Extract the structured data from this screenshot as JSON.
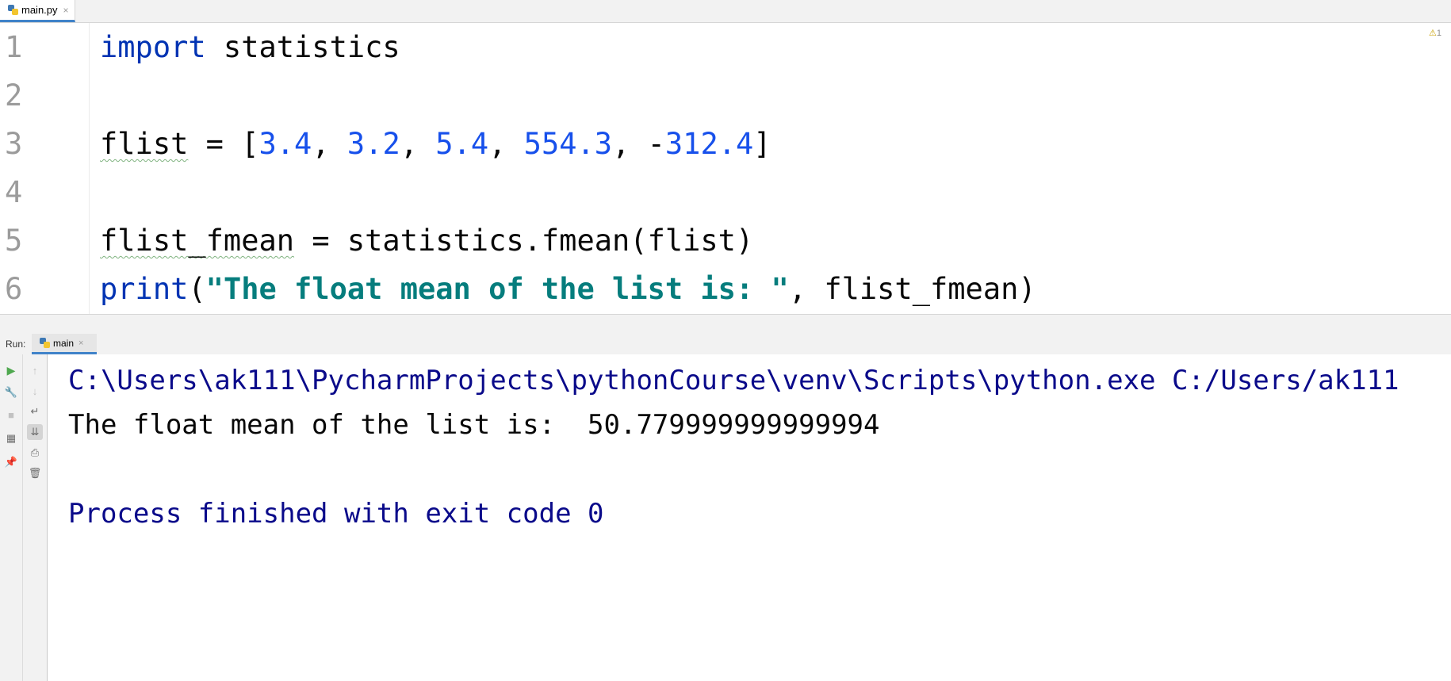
{
  "editor_tab": {
    "filename": "main.py",
    "close": "×"
  },
  "inspection": {
    "warning_count": "1"
  },
  "code": {
    "lines": [
      {
        "n": "1"
      },
      {
        "n": "2"
      },
      {
        "n": "3"
      },
      {
        "n": "4"
      },
      {
        "n": "5"
      },
      {
        "n": "6"
      }
    ],
    "l1": {
      "kw": "import",
      "rest": " statistics"
    },
    "l3": {
      "var": "flist",
      "eq": " = [",
      "n1": "3.4",
      "c1": ", ",
      "n2": "3.2",
      "c2": ", ",
      "n3": "5.4",
      "c3": ", ",
      "n4": "554.3",
      "c4": ", -",
      "n5": "312.4",
      "end": "]"
    },
    "l5": {
      "var": "flist_fmean",
      "rest": " = statistics.fmean(flist)"
    },
    "l6": {
      "fn": "print",
      "open": "(",
      "str": "\"The float mean of the list is: \"",
      "rest": ", flist_fmean)"
    }
  },
  "run_panel": {
    "label": "Run:",
    "tab": "main",
    "close": "×",
    "output": [
      "C:\\Users\\ak111\\PycharmProjects\\pythonCourse\\venv\\Scripts\\python.exe C:/Users/ak111",
      "The float mean of the list is:  50.779999999999994",
      "",
      "Process finished with exit code 0"
    ]
  }
}
